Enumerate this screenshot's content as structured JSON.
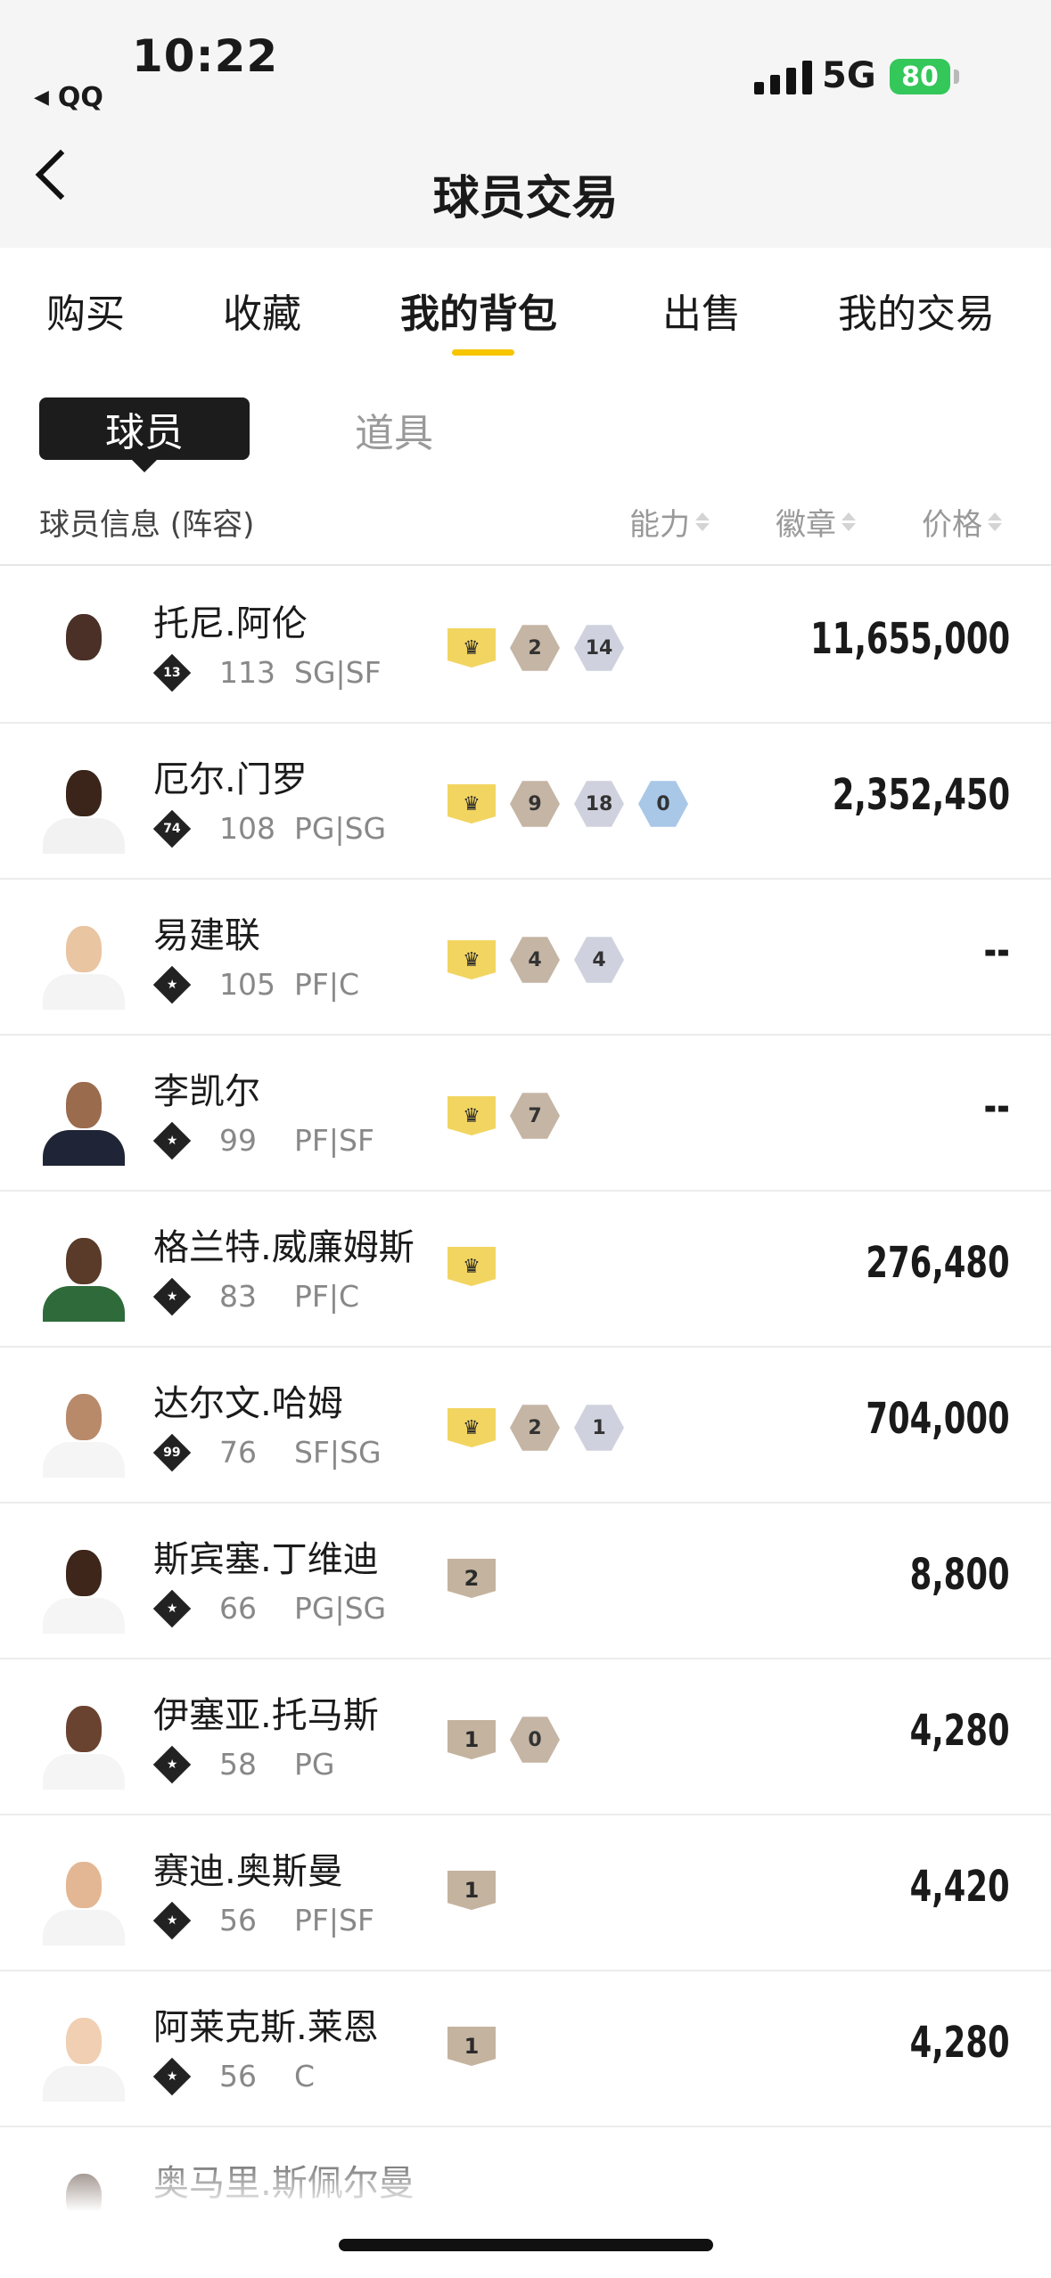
{
  "status_bar": {
    "time": "10:22",
    "back_app": "QQ",
    "network": "5G",
    "battery": "80"
  },
  "nav": {
    "title": "球员交易"
  },
  "tabs": [
    {
      "label": "购买",
      "active": false
    },
    {
      "label": "收藏",
      "active": false
    },
    {
      "label": "我的背包",
      "active": true
    },
    {
      "label": "出售",
      "active": false
    },
    {
      "label": "我的交易",
      "active": false
    }
  ],
  "segments": {
    "active": "球员",
    "other": "道具"
  },
  "columns": {
    "info": "球员信息 (阵容)",
    "ability": "能力",
    "badges": "徽章",
    "price": "价格"
  },
  "players": [
    {
      "name": "托尼.阿伦",
      "tier": "13",
      "ovr": "113",
      "pos": "SG|SF",
      "crown": true,
      "chips": [
        [
          "bronze",
          "2"
        ],
        [
          "silver",
          "14"
        ]
      ],
      "price": "11,655,000",
      "skin": "#4a3026",
      "jersey": "#ffffff"
    },
    {
      "name": "厄尔.门罗",
      "tier": "74",
      "ovr": "108",
      "pos": "PG|SG",
      "crown": true,
      "chips": [
        [
          "bronze",
          "9"
        ],
        [
          "silver",
          "18"
        ],
        [
          "blue",
          "0"
        ]
      ],
      "price": "2,352,450",
      "skin": "#3b2419",
      "jersey": "#f2f2f2"
    },
    {
      "name": "易建联",
      "tier": "",
      "ovr": "105",
      "pos": "PF|C",
      "crown": true,
      "chips": [
        [
          "bronze",
          "4"
        ],
        [
          "silver",
          "4"
        ]
      ],
      "price": "--",
      "skin": "#e9c5a2",
      "jersey": "#f4f4f4"
    },
    {
      "name": "李凯尔",
      "tier": "",
      "ovr": "99",
      "pos": "PF|SF",
      "crown": true,
      "chips": [
        [
          "bronze",
          "7"
        ]
      ],
      "price": "--",
      "skin": "#9a6b4d",
      "jersey": "#1f2436"
    },
    {
      "name": "格兰特.威廉姆斯",
      "tier": "",
      "ovr": "83",
      "pos": "PF|C",
      "crown": true,
      "chips": [],
      "price": "276,480",
      "skin": "#5a3a28",
      "jersey": "#2f6b3a"
    },
    {
      "name": "达尔文.哈姆",
      "tier": "99",
      "ovr": "76",
      "pos": "SF|SG",
      "crown": true,
      "chips": [
        [
          "bronze",
          "2"
        ],
        [
          "silver",
          "1"
        ]
      ],
      "price": "704,000",
      "skin": "#b88a6a",
      "jersey": "#f5f5f5"
    },
    {
      "name": "斯宾塞.丁维迪",
      "tier": "",
      "ovr": "66",
      "pos": "PG|SG",
      "crown": false,
      "num_badge": "2",
      "chips": [],
      "price": "8,800",
      "skin": "#3e261a",
      "jersey": "#f5f5f5"
    },
    {
      "name": "伊塞亚.托马斯",
      "tier": "",
      "ovr": "58",
      "pos": "PG",
      "crown": false,
      "num_badge": "1",
      "chips": [
        [
          "bronze",
          "0"
        ]
      ],
      "price": "4,280",
      "skin": "#6a4330",
      "jersey": "#f5f5f5"
    },
    {
      "name": "赛迪.奥斯曼",
      "tier": "",
      "ovr": "56",
      "pos": "PF|SF",
      "crown": false,
      "num_badge": "1",
      "chips": [],
      "price": "4,420",
      "skin": "#e3b793",
      "jersey": "#f4f4f4"
    },
    {
      "name": "阿莱克斯.莱恩",
      "tier": "",
      "ovr": "56",
      "pos": "C",
      "crown": false,
      "num_badge": "1",
      "chips": [],
      "price": "4,280",
      "skin": "#f0cfb3",
      "jersey": "#f4f4f4"
    },
    {
      "name": "奥马里.斯佩尔曼",
      "tier": "",
      "ovr": "",
      "pos": "",
      "crown": false,
      "chips": [],
      "price": "",
      "skin": "#3e261a",
      "jersey": "#f4f4f4"
    }
  ],
  "colors": {
    "accent": "#f6c500",
    "crown": "#f2d561"
  }
}
